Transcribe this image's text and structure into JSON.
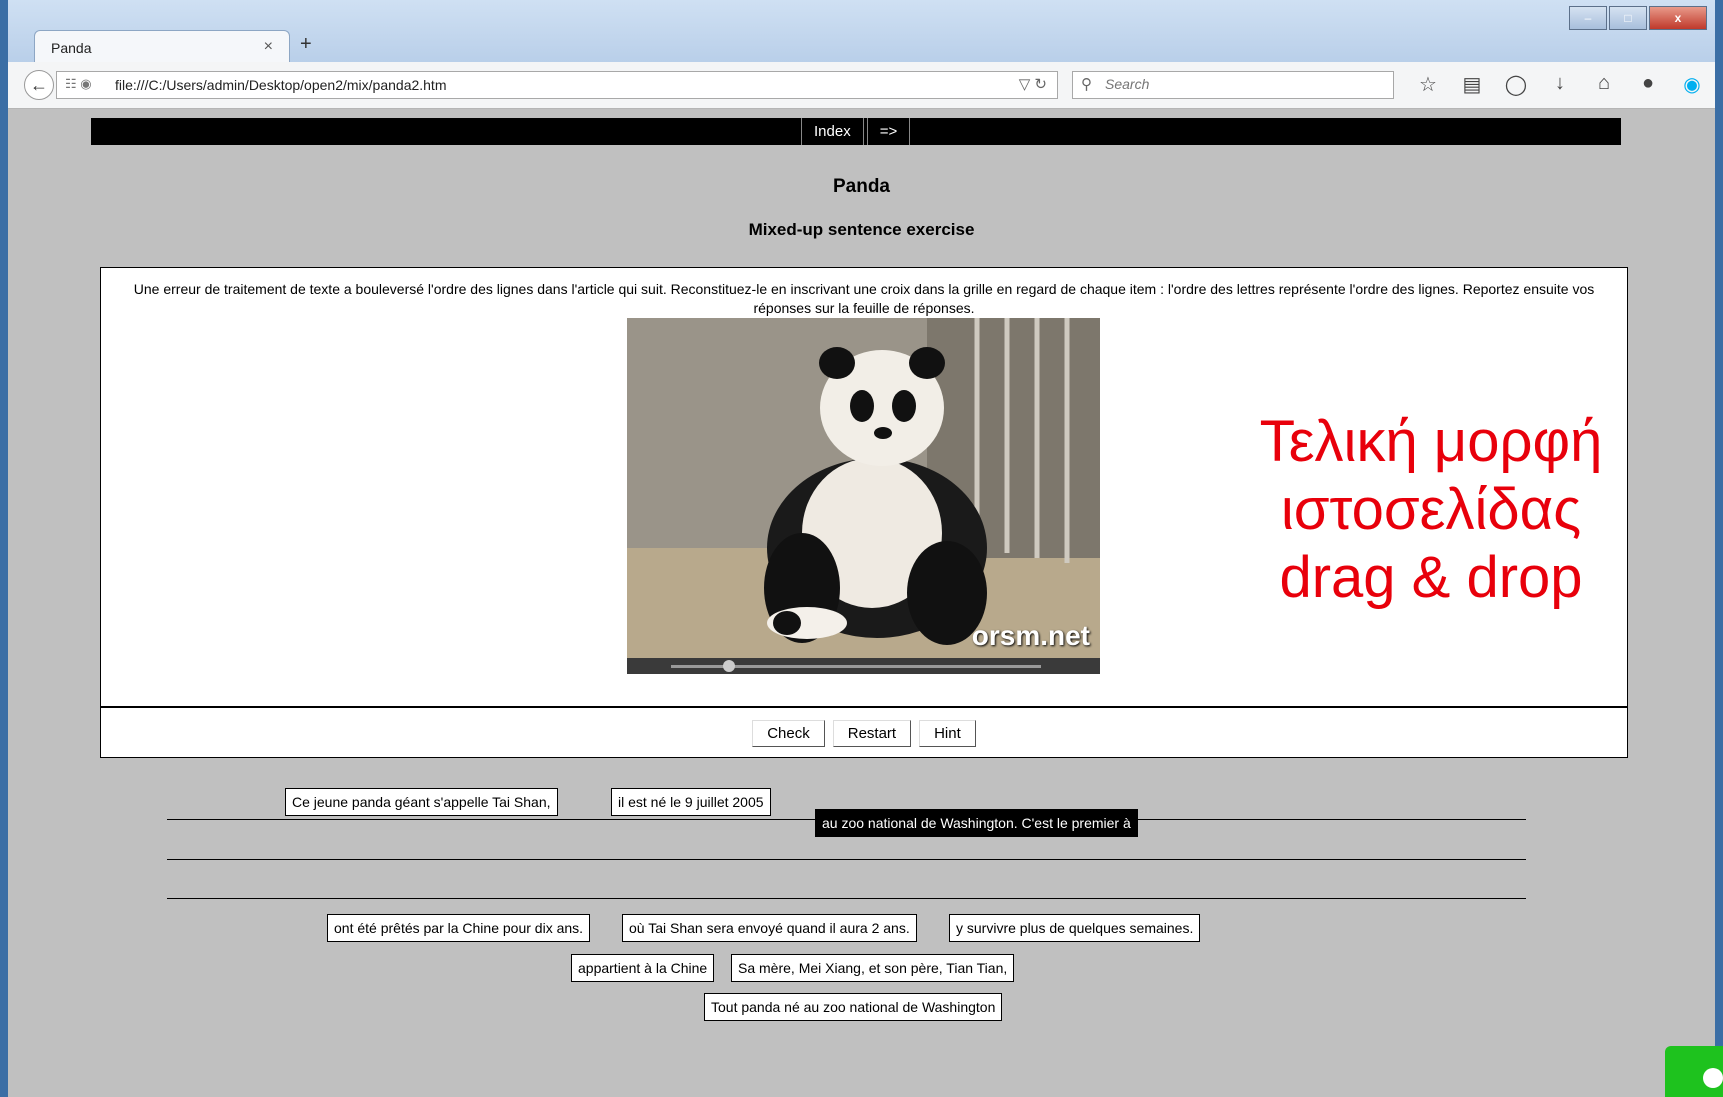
{
  "browser": {
    "tab_title": "Panda",
    "tab_close": "×",
    "new_tab": "+",
    "url": "file:///C:/Users/admin/Desktop/open2/mix/panda2.htm",
    "search_placeholder": "Search",
    "window_buttons": [
      "–",
      "□",
      "x"
    ]
  },
  "page": {
    "nav": {
      "index_label": "Index",
      "next_label": "=>"
    },
    "title": "Panda",
    "subtitle": "Mixed-up sentence exercise",
    "instructions": "Une erreur de traitement de texte a bouleversé l'ordre des lignes dans l'article qui suit. Reconstituez-le en inscrivant une croix dans la grille en regard de chaque item : l'ordre des lettres représente l'ordre des lignes. Reportez ensuite vos réponses sur la feuille de réponses.",
    "image_watermark": "orsm.net",
    "overlay_text": [
      "Τελική μορφή",
      "ιστοσελίδας",
      "drag & drop"
    ],
    "buttons": {
      "check": "Check",
      "restart": "Restart",
      "hint": "Hint"
    },
    "placed_fragments": [
      "Ce jeune panda géant s'appelle Tai Shan,",
      "il est né le 9 juillet 2005",
      "au zoo national de Washington. C'est le premier à"
    ],
    "pool_fragments": [
      "ont été prêtés par la Chine pour dix ans.",
      "où Tai Shan sera envoyé quand il aura 2 ans.",
      "y survivre plus de quelques semaines.",
      "appartient à la Chine",
      "Sa mère, Mei Xiang, et son père, Tian Tian,",
      "Tout panda né au zoo national de Washington"
    ]
  },
  "colors": {
    "page_bg": "#c0c0c0",
    "overlay_red": "#e8000b",
    "topbar": "#000000"
  }
}
